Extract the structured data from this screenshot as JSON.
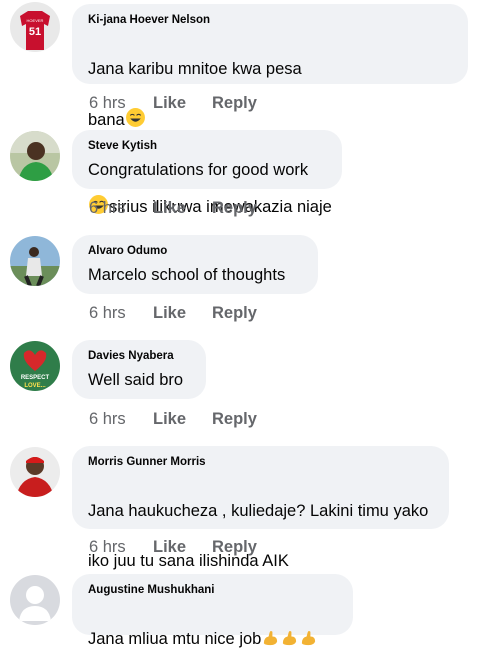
{
  "comments": [
    {
      "author": "Ki-jana Hoever Nelson",
      "text_line1": "Jana karibu mnitoe kwa pesa",
      "text_line2_a": "bana",
      "text_line2_b": "sirius ilikuwa imewakazia  niaje",
      "time": "6 hrs",
      "like": "Like",
      "reply": "Reply",
      "avatar": {
        "kind": "jersey",
        "number": "51",
        "label": "HOEVER",
        "color": "#c8102e"
      }
    },
    {
      "author": "Steve Kytish",
      "text_line1": "Congratulations for good work",
      "time": "6 hrs",
      "like": "Like",
      "reply": "Reply",
      "avatar": {
        "kind": "photo-person-green"
      }
    },
    {
      "author": "Alvaro Odumo",
      "text_line1": "Marcelo school of thoughts",
      "time": "6 hrs",
      "like": "Like",
      "reply": "Reply",
      "avatar": {
        "kind": "photo-person-sky"
      }
    },
    {
      "author": "Davies Nyabera",
      "text_line1": "Well said bro",
      "time": "6 hrs",
      "like": "Like",
      "reply": "Reply",
      "avatar": {
        "kind": "respect-love",
        "line1": "RESPECT",
        "line2": "LOVE..."
      }
    },
    {
      "author": "Morris Gunner Morris",
      "text_line1": "Jana haukucheza , kuliedaje? Lakini timu yako",
      "text_line2_a": "iko juu tu sana ilishinda AIK",
      "time": "6 hrs",
      "like": "Like",
      "reply": "Reply",
      "avatar": {
        "kind": "photo-person-red"
      }
    },
    {
      "author": "Augustine Mushukhani",
      "text_line1": "Jana mliua mtu nice job",
      "avatar": {
        "kind": "default-silhouette"
      }
    }
  ],
  "icons": {
    "grin": "grinning-face-emoji",
    "muscle": "flexed-biceps-emoji"
  }
}
